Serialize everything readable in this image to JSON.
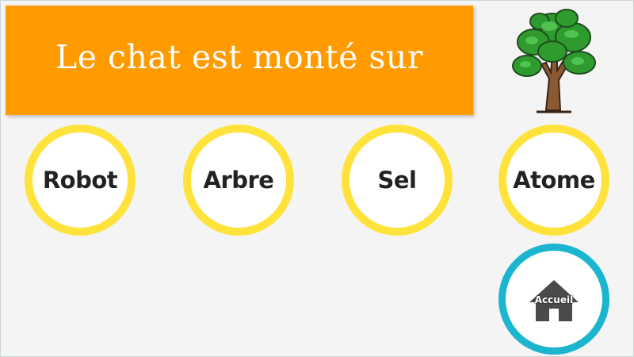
{
  "prompt": {
    "text": "Le chat est monté sur"
  },
  "prompt_image": {
    "icon": "tree-icon"
  },
  "choices": [
    {
      "label": "Robot"
    },
    {
      "label": "Arbre"
    },
    {
      "label": "Sel"
    },
    {
      "label": "Atome"
    }
  ],
  "home": {
    "label": "Accueil",
    "icon": "house-icon"
  },
  "colors": {
    "banner": "#ff9b00",
    "choice_ring": "#ffe33c",
    "home_ring": "#1bb5d0",
    "background": "#f4f4f4"
  }
}
